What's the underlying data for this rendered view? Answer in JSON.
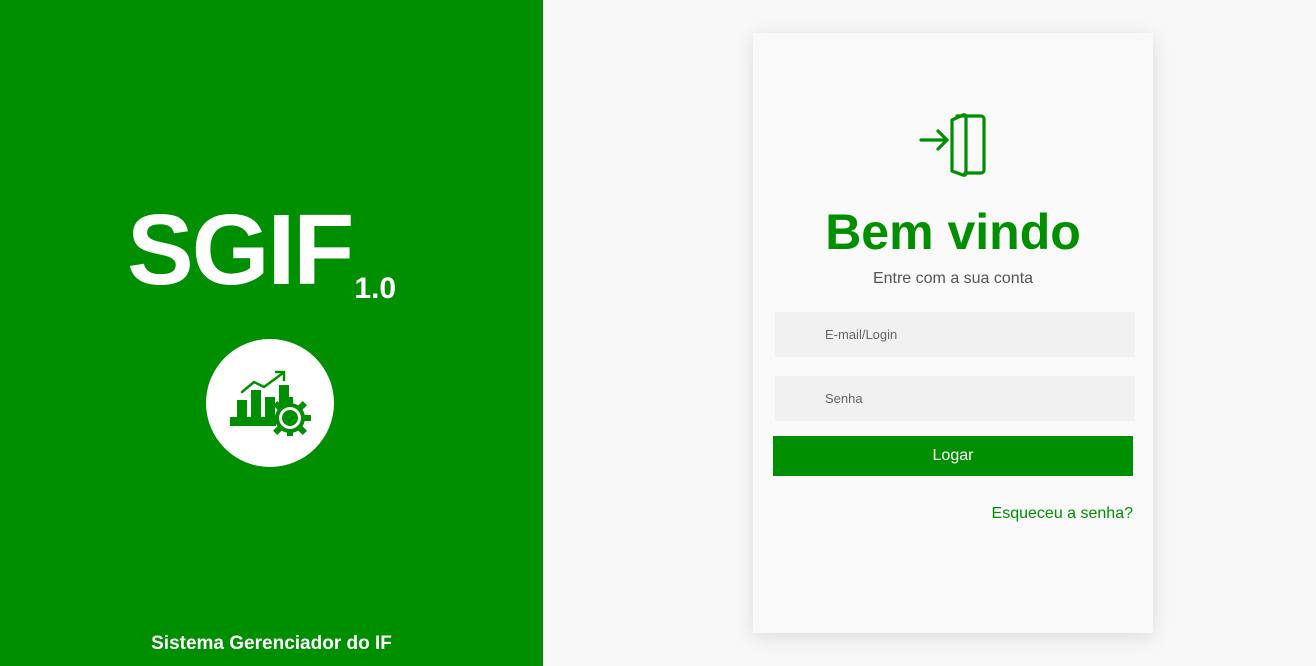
{
  "brand": {
    "name": "SGIF",
    "version": "1.0",
    "logo_icon": "chart-gear-icon",
    "footer": "Sistema Gerenciador do IF"
  },
  "login": {
    "icon": "login-door-icon",
    "title": "Bem vindo",
    "subtitle": "Entre com a sua conta",
    "email_placeholder": "E-mail/Login",
    "email_value": "",
    "password_placeholder": "Senha",
    "password_value": "",
    "submit_label": "Logar",
    "forgot_label": "Esqueceu a senha?"
  },
  "colors": {
    "brand_green": "#008f00",
    "background": "#f8f8f8",
    "field_background": "#f1f1f1",
    "white": "#ffffff"
  }
}
